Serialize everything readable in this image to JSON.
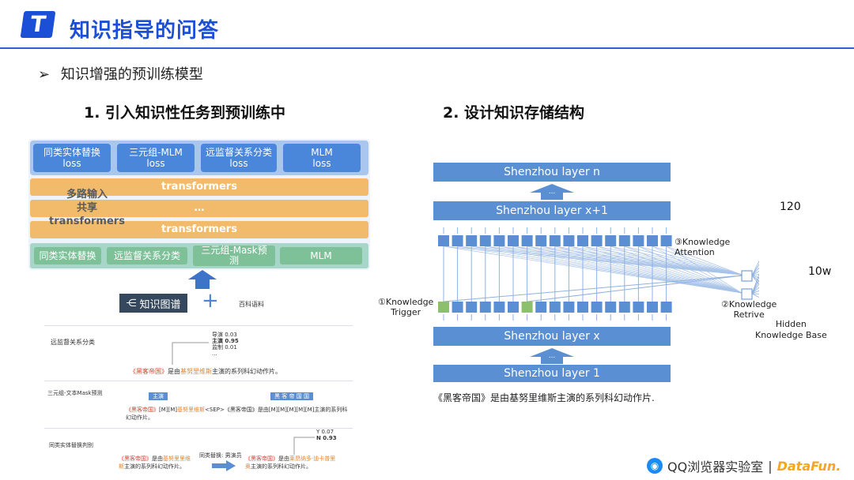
{
  "header": {
    "title": "知识指导的问答",
    "logo_glyph": "T"
  },
  "bullet": {
    "marker": "➢",
    "text": "知识增强的预训练模型"
  },
  "left": {
    "title": "1. 引入知识性任务到预训练中",
    "top_row": [
      "同类实体替换\nloss",
      "三元组-MLM\nloss",
      "远监督关系分类\nloss",
      "MLM\nloss"
    ],
    "bars": [
      "transformers",
      "…",
      "transformers"
    ],
    "multi_input": "多路输入\n共享\ntransformers",
    "bottom_row": [
      "同类实体替换",
      "远监督关系分类",
      "三元组-Mask预\n测",
      "MLM"
    ],
    "kg_label": "知识图谱",
    "plus": "+",
    "baike_label": "百科语料",
    "ex1": {
      "label": "远监督关系分类",
      "probs": [
        "导演 0.03",
        "主演 0.95",
        "监制 0.01",
        "..."
      ],
      "sent_pre": "《黑客帝国》",
      "sent_mid": "是由",
      "sent_ent": "基努里维斯",
      "sent_post": "主演的系列科幻动作片。"
    },
    "ex2": {
      "label": "三元组-文本Mask预测",
      "tok_left": "主演",
      "tok_right": "黑 客 帝 国 国",
      "line1_pre": "《黑客帝国》",
      "line1_mid": "[M][M]",
      "line1_ent": "基努里维斯",
      "line1_post": "<SEP>《黑客帝国》是由[M][M][M][M][M]主演的系列科",
      "line2": "幻动作片。"
    },
    "ex3": {
      "label": "同类实体替换判别",
      "yn": [
        "Y 0.07",
        "N 0.93"
      ],
      "left_pre": "《黑客帝国》",
      "left_mid": "是由",
      "left_ent": "基努里里维",
      "left_l2_ent": "斯",
      "left_l2": "主演的系列科幻动作片。",
      "arrow_label": "同类替换: 男演员",
      "right_pre": "《黑客帝国》",
      "right_mid": "是由",
      "right_ent": "莱昂纳多·迪卡普里",
      "right_l2_ent": "奥",
      "right_l2": "主演的系列科幻动作片。"
    }
  },
  "right": {
    "title": "2. 设计知识存储结构",
    "layers": {
      "n": "Shenzhou layer n",
      "x1": "Shenzhou layer x+1",
      "x": "Shenzhou layer x",
      "one": "Shenzhou layer 1"
    },
    "dots": "...",
    "knowledge_attention": "③Knowledge\nAttention",
    "knowledge_trigger": "①Knowledge\nTrigger",
    "knowledge_retrive": "②Knowledge\nRetrive",
    "kb_top": "120",
    "kb_side": "10w",
    "hidden_kb": "Hidden\nKnowledge Base",
    "caption": "《黑客帝国》是由基努里维斯主演的系列科幻动作片."
  },
  "footer": {
    "qq": "QQ浏览器实验室",
    "sep": "|",
    "datafun": "DataFun."
  },
  "colors": {
    "brand": "#1a4fd6",
    "layer": "#5b8fd3",
    "node_green": "#8cc06a",
    "kb_orange": "#e8883a"
  }
}
